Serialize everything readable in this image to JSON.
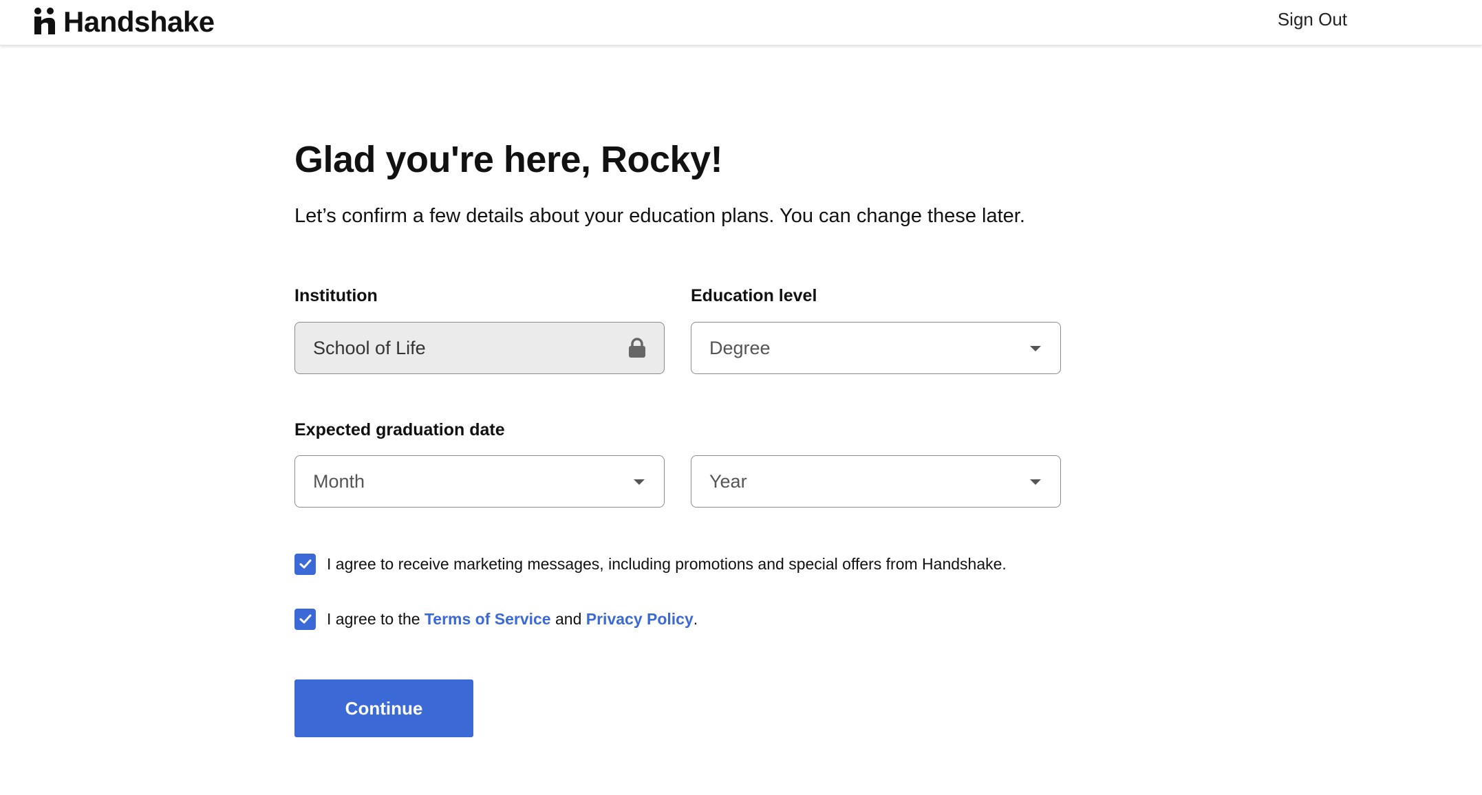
{
  "header": {
    "logo_text": "Handshake",
    "sign_out_label": "Sign Out"
  },
  "main": {
    "title": "Glad you're here, Rocky!",
    "subtitle": "Let’s confirm a few details about your education plans. You can change these later.",
    "institution": {
      "label": "Institution",
      "value": "School of Life",
      "locked": true
    },
    "education_level": {
      "label": "Education level",
      "placeholder": "Degree"
    },
    "graduation": {
      "label": "Expected graduation date",
      "month_placeholder": "Month",
      "year_placeholder": "Year"
    },
    "marketing_consent": {
      "checked": true,
      "text": "I agree to receive marketing messages, including promotions and special offers from Handshake."
    },
    "terms_consent": {
      "checked": true,
      "prefix": "I agree to the ",
      "terms_link": "Terms of Service",
      "middle": " and ",
      "privacy_link": "Privacy Policy",
      "suffix": "."
    },
    "continue_label": "Continue"
  },
  "colors": {
    "accent": "#3b6ad6",
    "locked_field_bg": "#ebebeb",
    "text": "#111111"
  },
  "icons": {
    "logo": "handshake-logo-icon",
    "lock": "lock-icon",
    "dropdown": "chevron-down-icon",
    "check": "checkmark-icon"
  }
}
